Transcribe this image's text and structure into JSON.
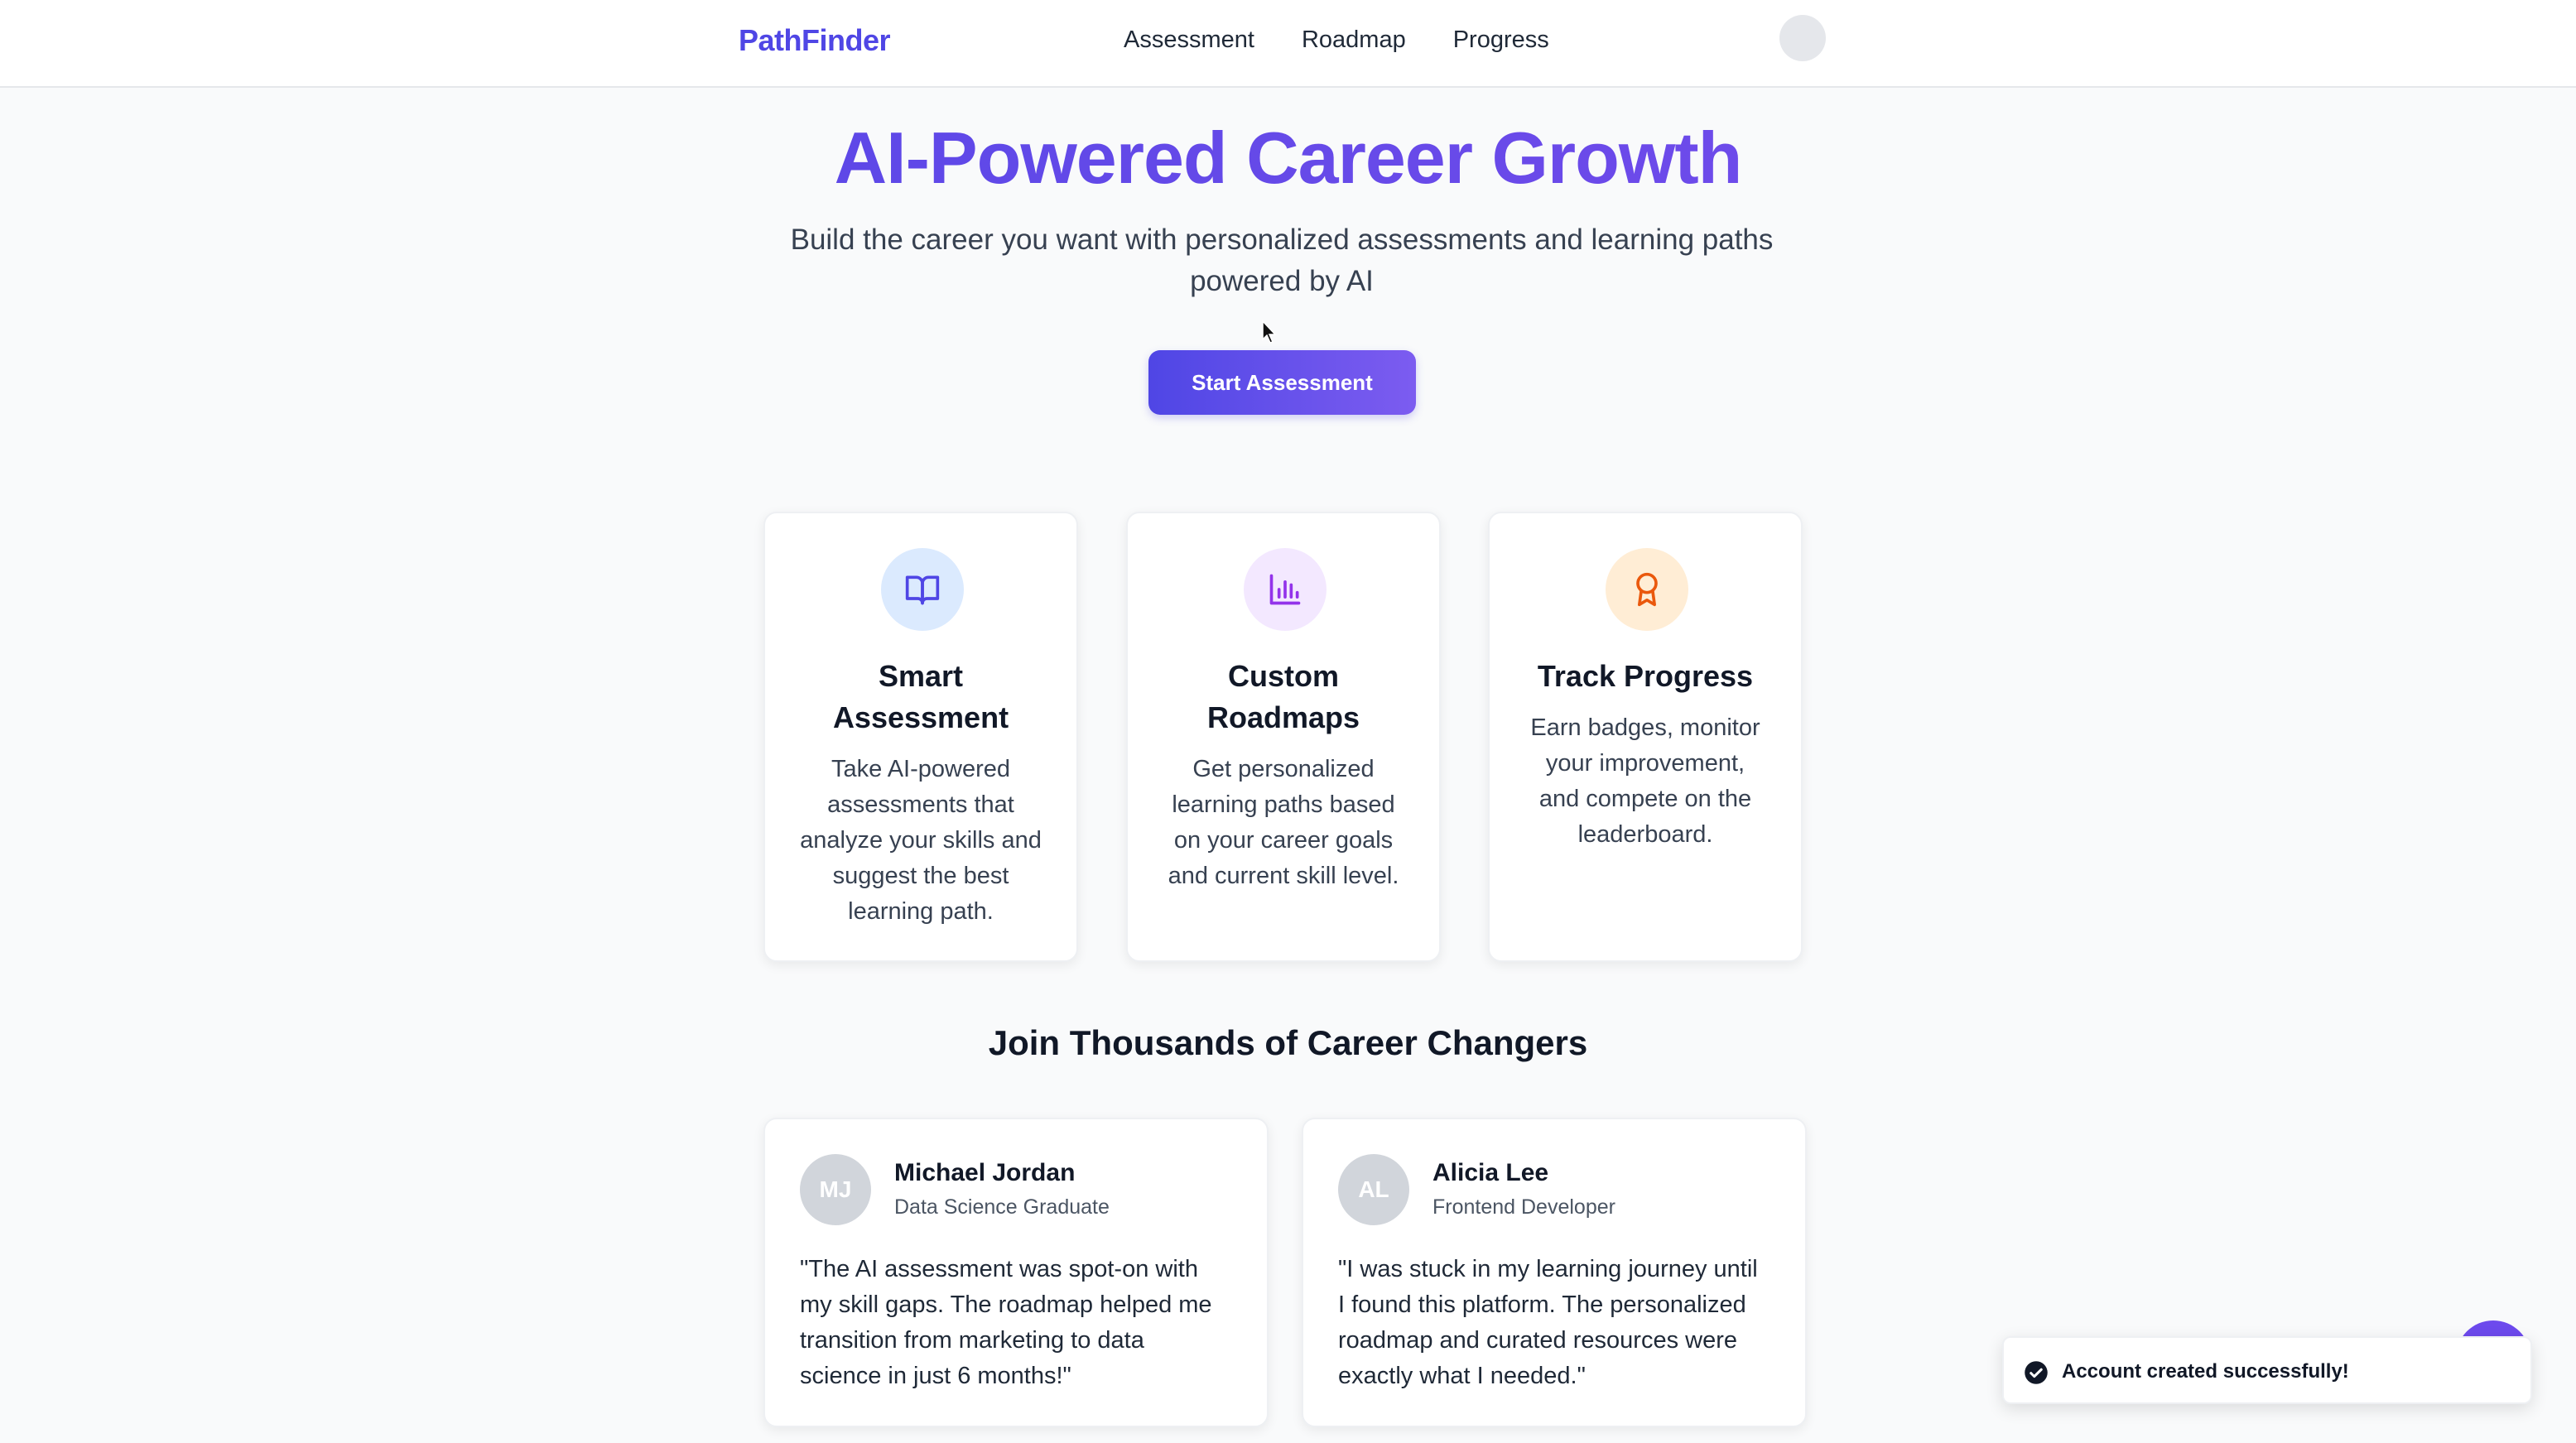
{
  "navbar": {
    "logo": "PathFinder",
    "links": [
      "Assessment",
      "Roadmap",
      "Progress"
    ]
  },
  "hero": {
    "title": "AI-Powered Career Growth",
    "subtitle": "Build the career you want with personalized assessments and learning paths powered by AI",
    "cta_label": "Start Assessment"
  },
  "features": [
    {
      "icon": "book-open-icon",
      "icon_bg": "#dbeafe",
      "icon_color": "#4f46e5",
      "title": "Smart Assessment",
      "description": "Take AI-powered assessments that analyze your skills and suggest the best learning path."
    },
    {
      "icon": "bar-chart-icon",
      "icon_bg": "#f3e8ff",
      "icon_color": "#9333ea",
      "title": "Custom Roadmaps",
      "description": "Get personalized learning paths based on your career goals and current skill level."
    },
    {
      "icon": "award-icon",
      "icon_bg": "#ffedd5",
      "icon_color": "#ea580c",
      "title": "Track Progress",
      "description": "Earn badges, monitor your improvement, and compete on the leaderboard."
    }
  ],
  "testimonials_section": {
    "title": "Join Thousands of Career Changers",
    "items": [
      {
        "initials": "MJ",
        "name": "Michael Jordan",
        "role": "Data Science Graduate",
        "quote": "\"The AI assessment was spot-on with my skill gaps. The roadmap helped me transition from marketing to data science in just 6 months!\""
      },
      {
        "initials": "AL",
        "name": "Alicia Lee",
        "role": "Frontend Developer",
        "quote": "\"I was stuck in my learning journey until I found this platform. The personalized roadmap and curated resources were exactly what I needed.\""
      }
    ]
  },
  "toast": {
    "icon": "check-circle-icon",
    "message": "Account created successfully!"
  },
  "colors": {
    "brand": "#4f46e5",
    "accent": "#7c4dec"
  }
}
